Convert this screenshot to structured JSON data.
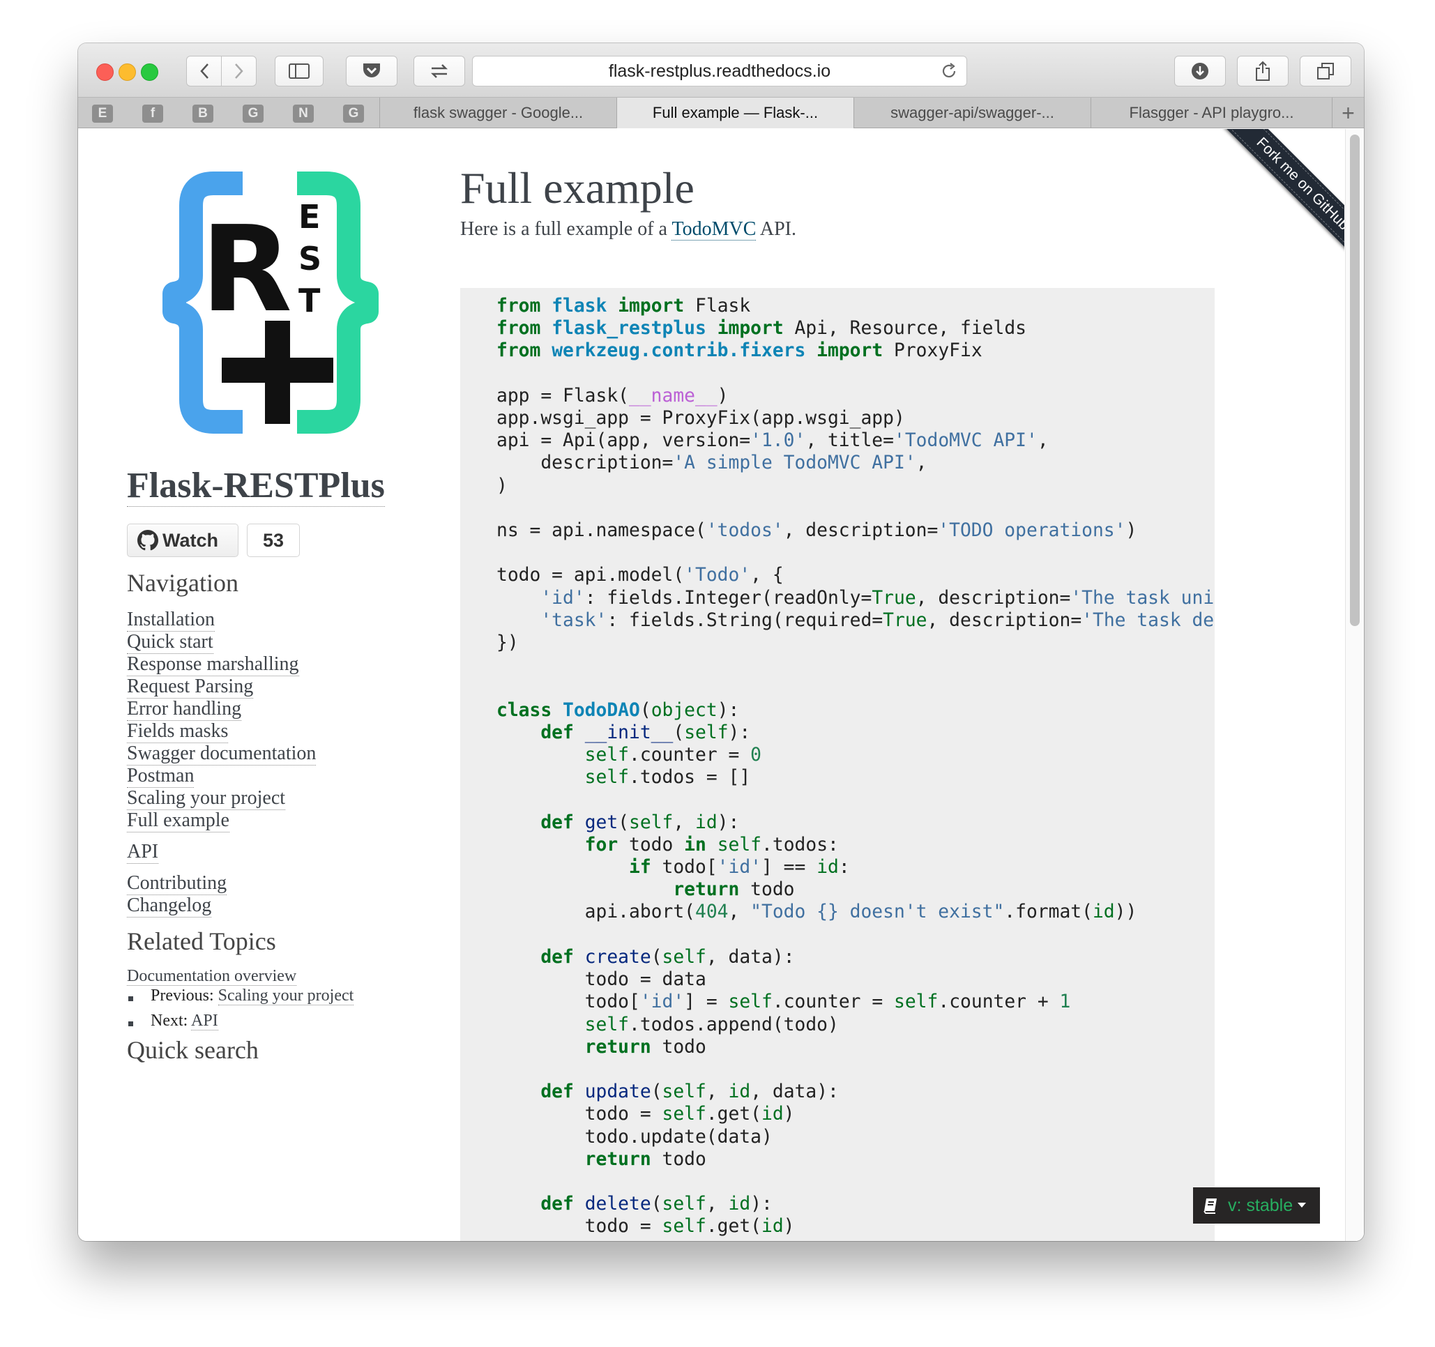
{
  "browser": {
    "url": "flask-restplus.readthedocs.io",
    "pinned_tabs": [
      "E",
      "f",
      "B",
      "G",
      "N",
      "G"
    ],
    "tabs": [
      {
        "label": "flask swagger - Google..."
      },
      {
        "label": "Full example — Flask-..."
      },
      {
        "label": "swagger-api/swagger-..."
      },
      {
        "label": "Flasgger - API playgro..."
      }
    ],
    "new_tab": "+"
  },
  "sidebar": {
    "logo_letters": {
      "r": "R",
      "e": "E",
      "s": "S",
      "t": "T"
    },
    "project_title": "Flask-RESTPlus",
    "watch_label": "Watch",
    "watch_count": "53",
    "navigation_heading": "Navigation",
    "nav_items": [
      "Installation",
      "Quick start",
      "Response marshalling",
      "Request Parsing",
      "Error handling",
      "Fields masks",
      "Swagger documentation",
      "Postman",
      "Scaling your project",
      "Full example"
    ],
    "api_link": "API",
    "extra_items": [
      "Contributing",
      "Changelog"
    ],
    "related_heading": "Related Topics",
    "doc_overview": "Documentation overview",
    "previous_label": "Previous:",
    "previous_link": "Scaling your project",
    "next_label": "Next:",
    "next_link": "API",
    "quick_search": "Quick search"
  },
  "main": {
    "title": "Full example",
    "intro_before": "Here is a full example of a ",
    "intro_link": "TodoMVC",
    "intro_after": " API.",
    "ribbon": "Fork me on GitHub"
  },
  "version_badge": {
    "label": "v: stable"
  },
  "colors": {
    "code_background": "#eeeeee",
    "keyword": "#007020",
    "string": "#4070a0",
    "link": "#004b6b",
    "logo_blue": "#4aa3ec",
    "logo_green": "#2bd6a0"
  }
}
